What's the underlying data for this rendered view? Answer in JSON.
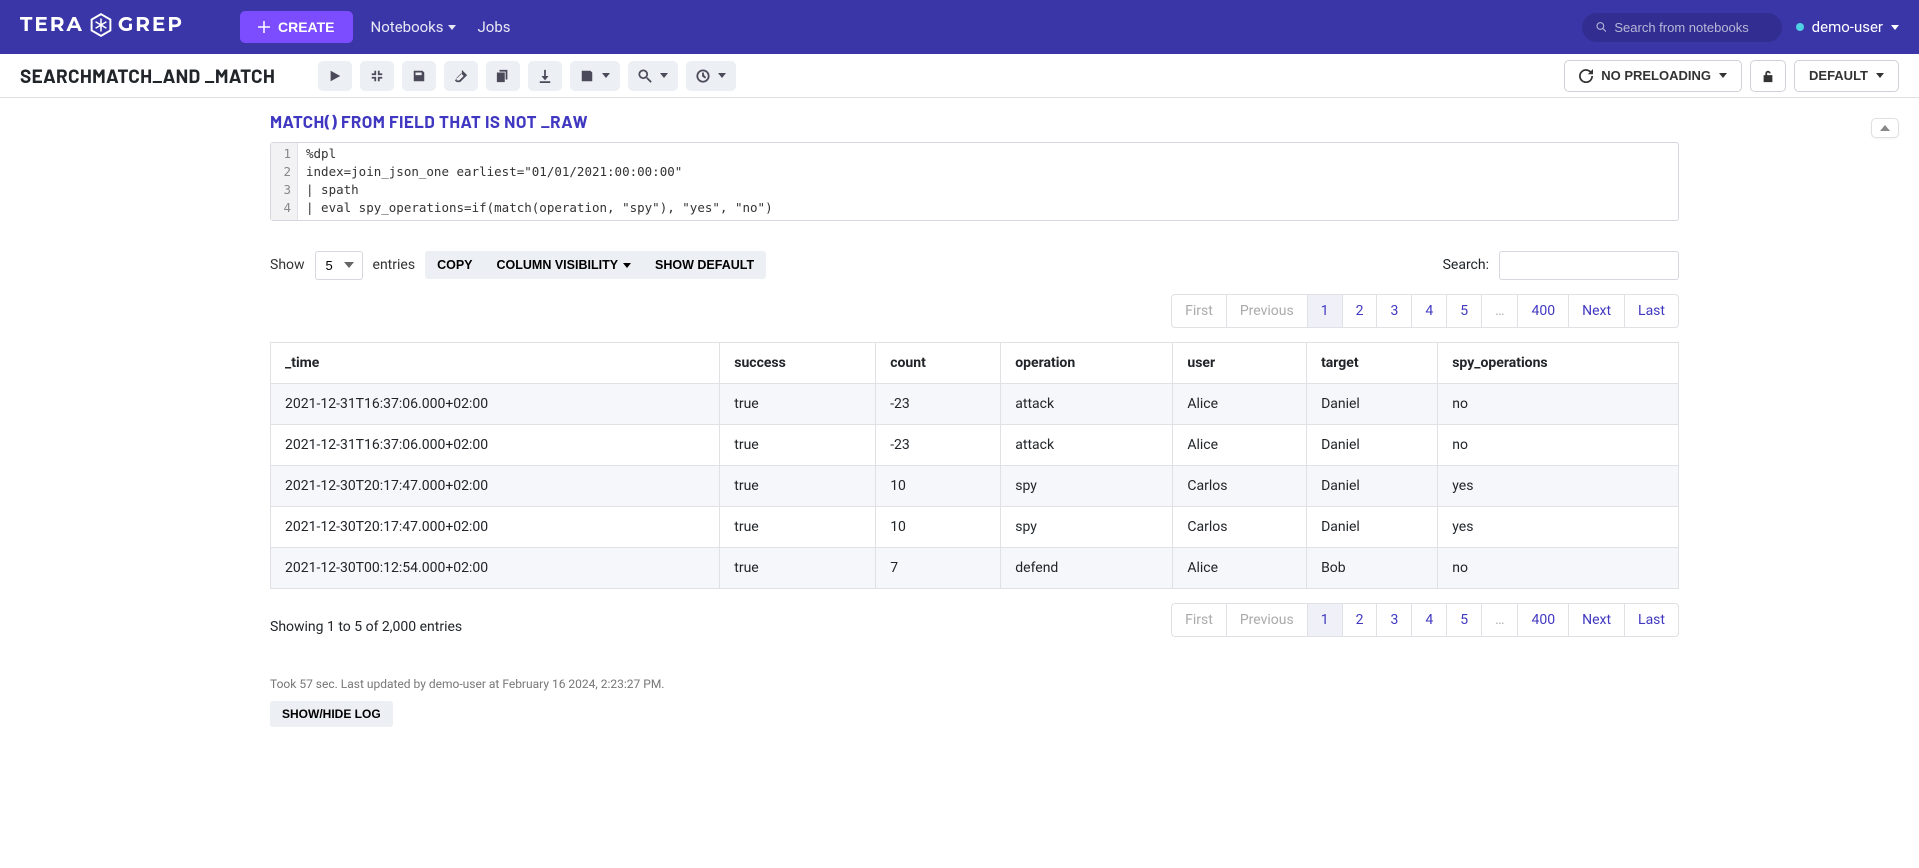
{
  "brand": {
    "left": "TERA",
    "right": "GREP"
  },
  "topbar": {
    "create": "CREATE",
    "notebooks": "Notebooks",
    "jobs": "Jobs",
    "search_placeholder": "Search from notebooks",
    "user": "demo-user"
  },
  "toolbar": {
    "title": "SEARCHMATCH_AND _MATCH",
    "no_preloading": "NO PRELOADING",
    "default": "DEFAULT"
  },
  "cell": {
    "title": "MATCH()  FROM  FIELD  THAT  IS  NOT  _RAW",
    "code_lines": [
      "%dpl",
      "index=join_json_one earliest=\"01/01/2021:00:00:00\"",
      "| spath",
      "| eval spy_operations=if(match(operation, \"spy\"), \"yes\", \"no\")"
    ]
  },
  "results": {
    "show_label": "Show",
    "entries_value": "5",
    "entries_label": "entries",
    "copy": "COPY",
    "colvis": "COLUMN VISIBILITY",
    "show_default": "SHOW DEFAULT",
    "search_label": "Search:",
    "columns": [
      "_time",
      "success",
      "count",
      "operation",
      "user",
      "target",
      "spy_operations"
    ],
    "rows": [
      [
        "2021-12-31T16:37:06.000+02:00",
        "true",
        "-23",
        "attack",
        "Alice",
        "Daniel",
        "no"
      ],
      [
        "2021-12-31T16:37:06.000+02:00",
        "true",
        "-23",
        "attack",
        "Alice",
        "Daniel",
        "no"
      ],
      [
        "2021-12-30T20:17:47.000+02:00",
        "true",
        "10",
        "spy",
        "Carlos",
        "Daniel",
        "yes"
      ],
      [
        "2021-12-30T20:17:47.000+02:00",
        "true",
        "10",
        "spy",
        "Carlos",
        "Daniel",
        "yes"
      ],
      [
        "2021-12-30T00:12:54.000+02:00",
        "true",
        "7",
        "defend",
        "Alice",
        "Bob",
        "no"
      ]
    ],
    "info": "Showing 1 to 5 of 2,000 entries",
    "pagination": {
      "first": "First",
      "previous": "Previous",
      "pages": [
        "1",
        "2",
        "3",
        "4",
        "5",
        "…",
        "400"
      ],
      "active_index": 0,
      "next": "Next",
      "last": "Last"
    },
    "meta": "Took 57 sec. Last updated by demo-user at February 16 2024, 2:23:27 PM.",
    "log_btn": "SHOW/HIDE LOG"
  }
}
